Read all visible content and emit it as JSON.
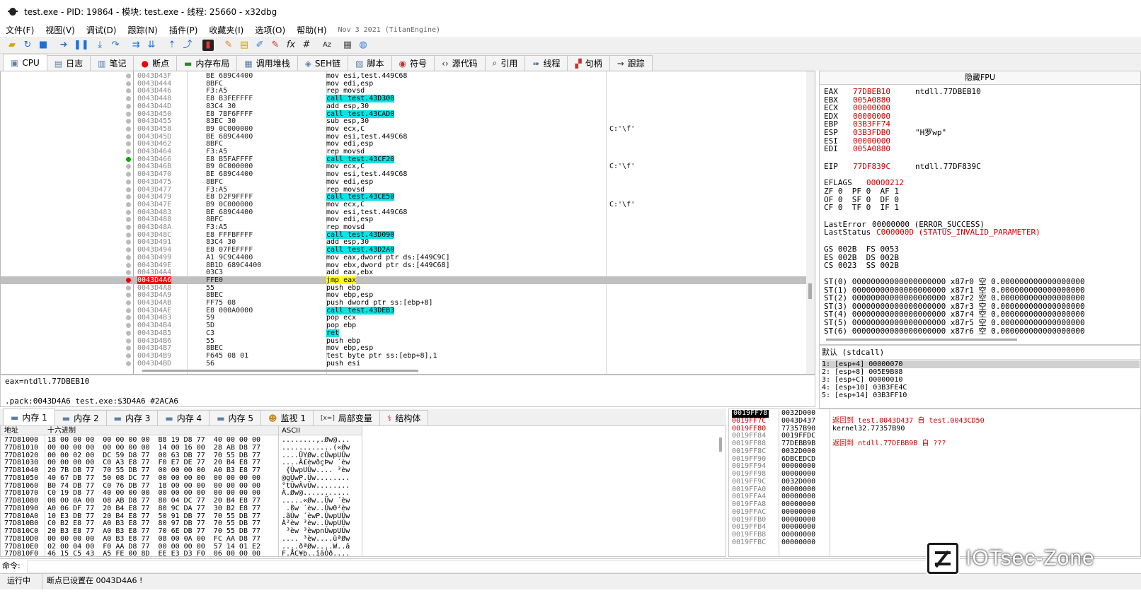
{
  "window": {
    "title": "test.exe - PID: 19864 - 模块: test.exe - 线程: 25660 - x32dbg"
  },
  "menu": {
    "items": [
      "文件(F)",
      "视图(V)",
      "调试(D)",
      "跟踪(N)",
      "插件(P)",
      "收藏夹(I)",
      "选项(O)",
      "帮助(H)"
    ],
    "version": "Nov 3 2021 (TitanEngine)"
  },
  "toolbar": {
    "icons": [
      "open-icon",
      "restart-icon",
      "stop-icon",
      "run-icon",
      "pause-icon",
      "step-into-icon",
      "step-over-icon",
      "trace-into-icon",
      "trace-over-icon",
      "execute-till-return-icon",
      "run-to-user-icon",
      "patch-icon",
      "comment-icon",
      "label-icon",
      "bookmark-icon",
      "function-icon",
      "fx-icon",
      "hash-icon",
      "font-icon",
      "calculator-icon",
      "globe-icon"
    ]
  },
  "tabs": [
    {
      "label": "CPU",
      "icon": "cpu-icon"
    },
    {
      "label": "日志",
      "icon": "log-icon"
    },
    {
      "label": "笔记",
      "icon": "notes-icon"
    },
    {
      "label": "断点",
      "icon": "breakpoint-icon"
    },
    {
      "label": "内存布局",
      "icon": "memory-map-icon"
    },
    {
      "label": "调用堆栈",
      "icon": "callstack-icon"
    },
    {
      "label": "SEH链",
      "icon": "seh-icon"
    },
    {
      "label": "脚本",
      "icon": "script-icon"
    },
    {
      "label": "符号",
      "icon": "symbols-icon"
    },
    {
      "label": "源代码",
      "icon": "source-icon"
    },
    {
      "label": "引用",
      "icon": "references-icon"
    },
    {
      "label": "线程",
      "icon": "threads-icon"
    },
    {
      "label": "句柄",
      "icon": "handles-icon"
    },
    {
      "label": "跟踪",
      "icon": "trace-icon"
    }
  ],
  "disasm": {
    "rows": [
      {
        "addr": "0043D43F",
        "bytes": "BE 689C4400",
        "instr": "mov esi,test.449C68",
        "comment": ""
      },
      {
        "addr": "0043D444",
        "bytes": "8BFC",
        "instr": "mov edi,esp",
        "comment": ""
      },
      {
        "addr": "0043D446",
        "bytes": "F3:A5",
        "instr": "rep movsd",
        "comment": ""
      },
      {
        "addr": "0043D448",
        "bytes": "E8 B3FEFFFF",
        "instr": "call test.43D300",
        "comment": "",
        "hl": "call"
      },
      {
        "addr": "0043D44D",
        "bytes": "83C4 30",
        "instr": "add esp,30",
        "comment": ""
      },
      {
        "addr": "0043D450",
        "bytes": "E8 7BF6FFFF",
        "instr": "call test.43CAD0",
        "comment": "",
        "hl": "call"
      },
      {
        "addr": "0043D455",
        "bytes": "83EC 30",
        "instr": "sub esp,30",
        "comment": ""
      },
      {
        "addr": "0043D458",
        "bytes": "B9 0C000000",
        "instr": "mov ecx,C",
        "comment": "C:'\\f'"
      },
      {
        "addr": "0043D45D",
        "bytes": "BE 689C4400",
        "instr": "mov esi,test.449C68",
        "comment": ""
      },
      {
        "addr": "0043D462",
        "bytes": "8BFC",
        "instr": "mov edi,esp",
        "comment": ""
      },
      {
        "addr": "0043D464",
        "bytes": "F3:A5",
        "instr": "rep movsd",
        "comment": ""
      },
      {
        "addr": "0043D466",
        "bytes": "E8 B5FAFFFF",
        "instr": "call test.43CF20",
        "comment": "",
        "hl": "call",
        "dot": "gr"
      },
      {
        "addr": "0043D46B",
        "bytes": "B9 0C000000",
        "instr": "mov ecx,C",
        "comment": "C:'\\f'"
      },
      {
        "addr": "0043D470",
        "bytes": "BE 689C4400",
        "instr": "mov esi,test.449C68",
        "comment": ""
      },
      {
        "addr": "0043D475",
        "bytes": "8BFC",
        "instr": "mov edi,esp",
        "comment": ""
      },
      {
        "addr": "0043D477",
        "bytes": "F3:A5",
        "instr": "rep movsd",
        "comment": ""
      },
      {
        "addr": "0043D479",
        "bytes": "E8 D2F9FFFF",
        "instr": "call test.43CE50",
        "comment": "",
        "hl": "call"
      },
      {
        "addr": "0043D47E",
        "bytes": "B9 0C000000",
        "instr": "mov ecx,C",
        "comment": "C:'\\f'"
      },
      {
        "addr": "0043D483",
        "bytes": "BE 689C4400",
        "instr": "mov esi,test.449C68",
        "comment": ""
      },
      {
        "addr": "0043D488",
        "bytes": "8BFC",
        "instr": "mov edi,esp",
        "comment": ""
      },
      {
        "addr": "0043D48A",
        "bytes": "F3:A5",
        "instr": "rep movsd",
        "comment": ""
      },
      {
        "addr": "0043D48C",
        "bytes": "E8 FFFBFFFF",
        "instr": "call test.43D090",
        "comment": "",
        "hl": "call"
      },
      {
        "addr": "0043D491",
        "bytes": "83C4 30",
        "instr": "add esp,30",
        "comment": ""
      },
      {
        "addr": "0043D494",
        "bytes": "E8 07FEFFFF",
        "instr": "call test.43D2A0",
        "comment": "",
        "hl": "call"
      },
      {
        "addr": "0043D499",
        "bytes": "A1 9C9C4400",
        "instr": "mov eax,dword ptr ds:[449C9C]",
        "comment": ""
      },
      {
        "addr": "0043D49E",
        "bytes": "8B1D 689C4400",
        "instr": "mov ebx,dword ptr ds:[449C68]",
        "comment": ""
      },
      {
        "addr": "0043D4A4",
        "bytes": "03C3",
        "instr": "add eax,ebx",
        "comment": ""
      },
      {
        "addr": "0043D4A6",
        "bytes": "FFE0",
        "instr": "jmp eax",
        "comment": "",
        "hl": "jmp",
        "cur": true,
        "dot": "bp"
      },
      {
        "addr": "0043D4A8",
        "bytes": "55",
        "instr": "push ebp",
        "comment": ""
      },
      {
        "addr": "0043D4A9",
        "bytes": "8BEC",
        "instr": "mov ebp,esp",
        "comment": ""
      },
      {
        "addr": "0043D4AB",
        "bytes": "FF75 08",
        "instr": "push dword ptr ss:[ebp+8]",
        "comment": ""
      },
      {
        "addr": "0043D4AE",
        "bytes": "E8 000A0000",
        "instr": "call test.43DEB3",
        "comment": "",
        "hl": "call"
      },
      {
        "addr": "0043D4B3",
        "bytes": "59",
        "instr": "pop ecx",
        "comment": ""
      },
      {
        "addr": "0043D4B4",
        "bytes": "5D",
        "instr": "pop ebp",
        "comment": ""
      },
      {
        "addr": "0043D4B5",
        "bytes": "C3",
        "instr": "ret",
        "comment": "",
        "hl": "call"
      },
      {
        "addr": "0043D4B6",
        "bytes": "55",
        "instr": "push ebp",
        "comment": ""
      },
      {
        "addr": "0043D4B7",
        "bytes": "8BEC",
        "instr": "mov ebp,esp",
        "comment": ""
      },
      {
        "addr": "0043D4B9",
        "bytes": "F645 08 01",
        "instr": "test byte ptr ss:[ebp+8],1",
        "comment": ""
      },
      {
        "addr": "0043D4BD",
        "bytes": "56",
        "instr": "push esi",
        "comment": ""
      }
    ]
  },
  "fpu": {
    "header": "隐藏FPU"
  },
  "registers": {
    "lines": [
      {
        "name": "EAX",
        "val": "77DBEB10",
        "note": "ntdll.77DBEB10"
      },
      {
        "name": "EBX",
        "val": "005A0880",
        "note": ""
      },
      {
        "name": "ECX",
        "val": "00000000",
        "note": ""
      },
      {
        "name": "EDX",
        "val": "00000000",
        "note": ""
      },
      {
        "name": "EBP",
        "val": "03B3FF74",
        "note": ""
      },
      {
        "name": "ESP",
        "val": "03B3FDB0",
        "note": "\"H罗wp\""
      },
      {
        "name": "ESI",
        "val": "00000000",
        "note": ""
      },
      {
        "name": "EDI",
        "val": "005A0880",
        "note": ""
      },
      {
        "name": "EIP",
        "val": "77DF839C",
        "note": "ntdll.77DF839C"
      }
    ],
    "eflags": {
      "name": "EFLAGS",
      "val": "00000212"
    },
    "flags": [
      "ZF 0  PF 0  AF 1",
      "OF 0  SF 0  DF 0",
      "CF 0  TF 0  IF 1"
    ],
    "last_error": {
      "name": "LastError",
      "val": "00000000 (ERROR_SUCCESS)"
    },
    "last_status": {
      "name": "LastStatus",
      "val": "C000000D (STATUS_INVALID_PARAMETER)"
    },
    "segments": [
      "GS 002B  FS 0053",
      "ES 002B  DS 002B",
      "CS 0023  SS 002B"
    ],
    "fpu_regs": [
      "ST(0) 00000000000000000000 x87r0 空 0.000000000000000000",
      "ST(1) 00000000000000000000 x87r1 空 0.000000000000000000",
      "ST(2) 00000000000000000000 x87r2 空 0.000000000000000000",
      "ST(3) 00000000000000000000 x87r3 空 0.000000000000000000",
      "ST(4) 00000000000000000000 x87r4 空 0.000000000000000000",
      "ST(5) 00000000000000000000 x87r5 空 0.000000000000000000",
      "ST(6) 00000000000000000000 x87r6 空 0.000000000000000000"
    ]
  },
  "info": {
    "line1": "eax=ntdll.77DBEB10",
    "line2": ".pack:0043D4A6 test.exe:$3D4A6 #2ACA6"
  },
  "stack_args": {
    "convention": "默认 (stdcall)",
    "args": [
      "1: [esp+4] 00000070",
      "2: [esp+8] 005E9B08",
      "3: [esp+C] 00000010",
      "4: [esp+10] 03B3FE4C",
      "5: [esp+14] 03B3FF10"
    ]
  },
  "dump_tabs": [
    {
      "label": "内存 1",
      "icon": "memory-icon"
    },
    {
      "label": "内存 2",
      "icon": "memory-icon"
    },
    {
      "label": "内存 3",
      "icon": "memory-icon"
    },
    {
      "label": "内存 4",
      "icon": "memory-icon"
    },
    {
      "label": "内存 5",
      "icon": "memory-icon"
    },
    {
      "label": "监视 1",
      "icon": "watch-icon"
    },
    {
      "label": "局部变量",
      "icon": "locals-icon",
      "prefix": "[x=]"
    },
    {
      "label": "结构体",
      "icon": "struct-icon"
    }
  ],
  "dump": {
    "headers": {
      "addr": "地址",
      "hex": "十六进制",
      "ascii": "ASCII"
    },
    "rows": [
      {
        "a": "77D81000",
        "h": "18 00 00 00  00 00 00 00  B8 19 D8 77  40 00 00 00",
        "c": "........,.Øw@..."
      },
      {
        "a": "77D81010",
        "h": "00 00 00 00  00 00 00 00  14 00 16 00  28 AB D8 77",
        "c": "............(«Øw"
      },
      {
        "a": "77D81020",
        "h": "00 00 02 00  DC 59 D8 77  00 63 DB 77  70 55 DB 77",
        "c": "....ÜYØw.cÛwpUÛw"
      },
      {
        "a": "77D81030",
        "h": "00 00 00 00  C0 A3 E8 77  F0 E7 DE 77  20 B4 E8 77",
        "c": "....À£èwðçÞw ´èw"
      },
      {
        "a": "77D81040",
        "h": "20 7B DB 77  70 55 DB 77  00 00 00 00  A0 B3 E8 77",
        "c": " {ÛwpUÛw.... ³èw"
      },
      {
        "a": "77D81050",
        "h": "40 67 DB 77  50 08 DC 77  00 00 00 00  00 00 00 00",
        "c": "@gÛwP.Üw........"
      },
      {
        "a": "77D81060",
        "h": "B0 74 DB 77  C0 76 DB 77  18 00 00 00  00 00 00 00",
        "c": "°tÛwÀvÛw........"
      },
      {
        "a": "77D81070",
        "h": "C0 19 D8 77  40 00 00 00  00 00 00 00  00 00 00 00",
        "c": "À.Øw@..........."
      },
      {
        "a": "77D81080",
        "h": "08 00 0A 00  08 AB D8 77  80 04 DC 77  20 B4 E8 77",
        "c": ".....«Øw..Üw ´èw"
      },
      {
        "a": "77D81090",
        "h": "A0 06 DF 77  20 B4 E8 77  80 9C DA 77  30 B2 E8 77",
        "c": " .ßw ´èw..Úw0²èw"
      },
      {
        "a": "77D810A0",
        "h": "10 E3 DB 77  20 B4 E8 77  50 91 DB 77  70 55 DB 77",
        "c": ".ãÛw ´èwP.ÛwpUÛw"
      },
      {
        "a": "77D810B0",
        "h": "C0 B2 E8 77  A0 B3 E8 77  80 97 DB 77  70 55 DB 77",
        "c": "À²èw ³èw..ÛwpUÛw"
      },
      {
        "a": "77D810C0",
        "h": "20 B3 E8 77  A0 B3 E8 77  70 6E DB 77  70 55 DB 77",
        "c": " ³èw ³èwpnÛwpUÛw"
      },
      {
        "a": "77D810D0",
        "h": "00 00 00 00  A0 B3 E8 77  08 00 0A 00  FC AA D8 77",
        "c": ".... ³èw....üªØw"
      },
      {
        "a": "77D810E0",
        "h": "02 00 04 00  F0 AA D8 77  00 00 00 00  57 14 01 E2",
        "c": "....ðªØw....W..â"
      },
      {
        "a": "77D810F0",
        "h": "46 15 C5 43  A5 FE 00 8D  EE E3 D3 F0  06 00 00 00",
        "c": "F.ÅC¥þ..îãÓð...."
      }
    ]
  },
  "stack": {
    "rows": [
      {
        "a": "0019FF78",
        "v": "0032D000",
        "c": ""
      },
      {
        "a": "0019FF7C",
        "v": "0043D437",
        "c": "返回到 test.0043D437 自 test.0043CD50"
      },
      {
        "a": "0019FF80",
        "v": "77357B90",
        "c": "kernel32.77357B90"
      },
      {
        "a": "0019FF84",
        "v": "0019FFDC",
        "c": ""
      },
      {
        "a": "0019FF88",
        "v": "77DEBB9B",
        "c": "返回到 ntdll.77DEBB9B 自 ???"
      },
      {
        "a": "0019FF8C",
        "v": "0032D000",
        "c": ""
      },
      {
        "a": "0019FF90",
        "v": "6DBCEDCD",
        "c": ""
      },
      {
        "a": "0019FF94",
        "v": "00000000",
        "c": ""
      },
      {
        "a": "0019FF98",
        "v": "00000000",
        "c": ""
      },
      {
        "a": "0019FF9C",
        "v": "0032D000",
        "c": ""
      },
      {
        "a": "0019FFA0",
        "v": "00000000",
        "c": ""
      },
      {
        "a": "0019FFA4",
        "v": "00000000",
        "c": ""
      },
      {
        "a": "0019FFA8",
        "v": "00000000",
        "c": ""
      },
      {
        "a": "0019FFAC",
        "v": "00000000",
        "c": ""
      },
      {
        "a": "0019FFB0",
        "v": "00000000",
        "c": ""
      },
      {
        "a": "0019FFB4",
        "v": "00000000",
        "c": ""
      },
      {
        "a": "0019FFB8",
        "v": "00000000",
        "c": ""
      },
      {
        "a": "0019FFBC",
        "v": "00000000",
        "c": ""
      }
    ]
  },
  "command": {
    "label": "命令:",
    "value": ""
  },
  "status": {
    "state": "运行中",
    "message": "断点已设置在 0043D4A6 !"
  },
  "watermark": {
    "text": "IOTsec-Zone"
  },
  "colors": {
    "current_ip": "#e00000",
    "call_highlight": "#00e5e5",
    "jmp_highlight": "#ffff00",
    "modified_reg": "#c00000"
  }
}
